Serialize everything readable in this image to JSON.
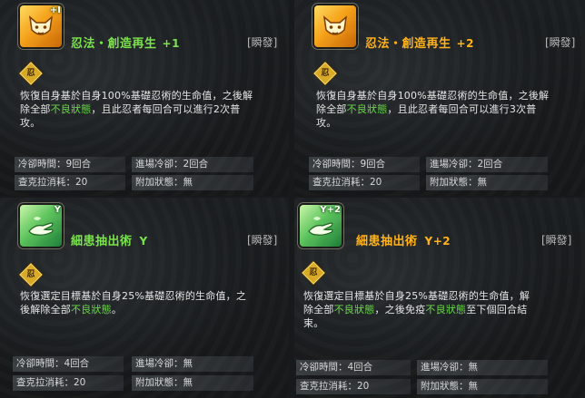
{
  "cards": [
    {
      "name": "忍法・創造再生",
      "level": "+1",
      "instant": "[瞬發]",
      "emblem": "忍",
      "desc": {
        "line1": "恢復自身基於自身100%基礎忍術的生命值，之後解",
        "line2_a": "除全部",
        "line2_green": "不良狀態",
        "line2_b": "，且此忍者每回合可以進行2次普",
        "line3": "攻。"
      },
      "stats": {
        "cooldown": "冷卻時間：9回合",
        "entry_cooldown": "進場冷卻：2回合",
        "chakra": "查克拉消耗：20",
        "extra_status": "附加狀態：無"
      },
      "icon": "fox-face-icon",
      "icon_tag": "+I",
      "title_color": "#7ae24c"
    },
    {
      "name": "忍法・創造再生",
      "level": "+2",
      "instant": "[瞬發]",
      "emblem": "忍",
      "desc": {
        "line1": "恢復自身基於自身100%基礎忍術的生命值，之後解",
        "line2_a": "除全部",
        "line2_green": "不良狀態",
        "line2_b": "，且此忍者每回合可以進行3次普",
        "line3": "攻。"
      },
      "stats": {
        "cooldown": "冷卻時間：9回合",
        "entry_cooldown": "進場冷卻：2回合",
        "chakra": "查克拉消耗：20",
        "extra_status": "附加狀態：無"
      },
      "icon": "fox-face-icon",
      "icon_tag": "",
      "title_color": "#ffb21a"
    },
    {
      "name": "細患抽出術",
      "level": "Y",
      "instant": "[瞬發]",
      "emblem": "忍",
      "desc": {
        "line1_a": "恢復選定目標基於自身25%基礎忍術的生命值，之",
        "line2_a": "後解除全部",
        "line2_green": "不良狀態",
        "line2_b": "。"
      },
      "stats": {
        "cooldown": "冷卻時間：4回合",
        "entry_cooldown": "進場冷卻：無",
        "chakra": "查克拉消耗：20",
        "extra_status": "附加狀態：無"
      },
      "icon": "healing-hand-icon",
      "icon_tag": "Y",
      "title_color": "#7ae24c"
    },
    {
      "name": "細患抽出術",
      "level": "Y+2",
      "instant": "[瞬發]",
      "emblem": "忍",
      "desc": {
        "line1": "恢復選定目標基於自身25%基礎忍術的生命值，解",
        "line2_a": "除全部",
        "line2_green": "不良狀態",
        "line2_b": "，之後免疫",
        "line2_green2": "不良狀態",
        "line2_c": "至下個回合結",
        "line3": "束。"
      },
      "stats": {
        "cooldown": "冷卻時間：4回合",
        "entry_cooldown": "進場冷卻：無",
        "chakra": "查克拉消耗：20",
        "extra_status": "附加狀態：無"
      },
      "icon": "healing-hand-icon",
      "icon_tag": "Y+2",
      "title_color": "#ffb21a"
    }
  ]
}
